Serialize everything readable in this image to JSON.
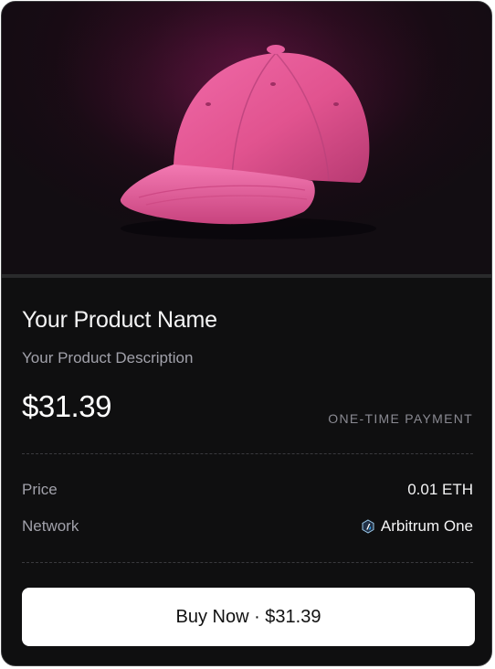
{
  "product": {
    "name": "Your Product Name",
    "description": "Your Product Description",
    "price_display": "$31.39",
    "payment_type": "ONE-TIME PAYMENT",
    "image_icon": "pink-baseball-cap"
  },
  "details": {
    "price_label": "Price",
    "price_value": "0.01 ETH",
    "network_label": "Network",
    "network_value": "Arbitrum One",
    "network_icon": "arbitrum-icon"
  },
  "button": {
    "label": "Buy Now · $31.39"
  },
  "colors": {
    "card_background": "#0f0f10",
    "cap_pink": "#e85a9c",
    "button_background": "#ffffff"
  }
}
